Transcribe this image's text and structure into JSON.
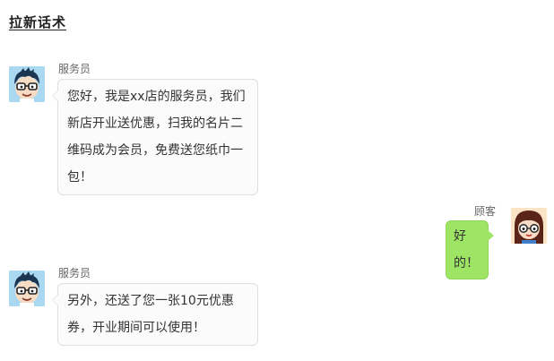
{
  "page": {
    "title": "拉新话术"
  },
  "messages": [
    {
      "role": "staff",
      "sender": "服务员",
      "text": "您好，我是xx店的服务员，我们新店开业送优惠，扫我的名片二维码成为会员，免费送您纸巾一包！"
    },
    {
      "role": "customer",
      "sender": "顾客",
      "text": "好的！"
    },
    {
      "role": "staff",
      "sender": "服务员",
      "text": "另外，还送了您一张10元优惠券，开业期间可以使用！"
    }
  ],
  "colors": {
    "customer_bubble": "#9ee465",
    "staff_bubble": "#fbfbfb",
    "bubble_border": "#dfdfdf",
    "staff_avatar_bg": "#a9d8f0",
    "customer_avatar_bg": "#fbe3c6"
  },
  "icons": {
    "staff_avatar": "cartoon-boy-with-glasses-icon",
    "customer_avatar": "cartoon-girl-with-glasses-icon"
  }
}
